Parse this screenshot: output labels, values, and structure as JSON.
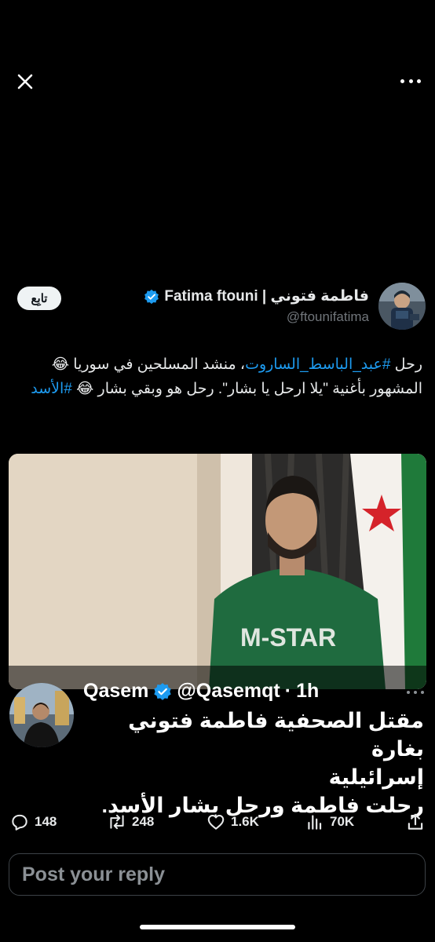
{
  "header": {
    "display_name": "فاطمة فتوني | Fatima ftouni",
    "handle": "@ftounifatima",
    "follow_label": "تابِع"
  },
  "tweet": {
    "text_part1": "رحل ",
    "hashtag1": "#عبد_الباسط_الساروت",
    "text_part2": "، منشد المسلحين في سوريا 😂 المشهور بأغنية  \"يلا ارحل يا بشار\". رحل هو  وبقي بشار 😂 ",
    "hashtag2": "#الأسد"
  },
  "media": {
    "shirt_text": "M-STAR"
  },
  "quote": {
    "name": "Qasem",
    "handle": "@Qasemqt",
    "separator": "·",
    "time": "1h",
    "line1": "مقتل الصحفية فاطمة فتوني بغارة",
    "line2": "إسرائيلية",
    "line3": "رحلت فاطمة ورحل بشار الأسد."
  },
  "actions": {
    "replies": "148",
    "reposts": "248",
    "likes": "1.6K",
    "views": "70K"
  },
  "reply_box": {
    "placeholder": "Post your reply"
  },
  "icons": {
    "close": "close-icon",
    "more": "more-icon",
    "verified": "verified-badge-icon",
    "reply": "reply-icon",
    "repost": "repost-icon",
    "like": "heart-icon",
    "views": "views-icon",
    "share": "share-icon"
  },
  "colors": {
    "background": "#000000",
    "accent": "#1d9bf0",
    "secondary_text": "#71767b"
  }
}
